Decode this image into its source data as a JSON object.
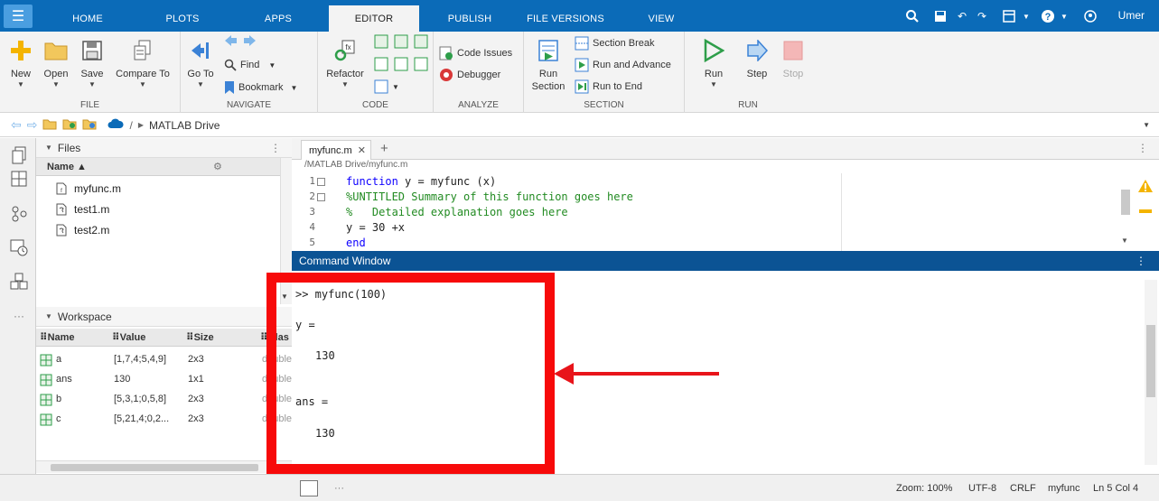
{
  "tabs": [
    {
      "label": "HOME",
      "active": false
    },
    {
      "label": "PLOTS",
      "active": false
    },
    {
      "label": "APPS",
      "active": false
    },
    {
      "label": "EDITOR",
      "active": true
    },
    {
      "label": "PUBLISH",
      "active": false
    },
    {
      "label": "FILE VERSIONS",
      "active": false
    },
    {
      "label": "VIEW",
      "active": false
    }
  ],
  "user": {
    "name": "Umer"
  },
  "ribbon": {
    "file": {
      "label": "FILE",
      "new": "New",
      "open": "Open",
      "save": "Save",
      "compare": "Compare To"
    },
    "navigate": {
      "label": "NAVIGATE",
      "goto": "Go To",
      "find": "Find",
      "bookmark": "Bookmark"
    },
    "code": {
      "label": "CODE",
      "refactor": "Refactor"
    },
    "analyze": {
      "label": "ANALYZE",
      "code_issues": "Code Issues",
      "debugger": "Debugger"
    },
    "section": {
      "label": "SECTION",
      "run_section_1": "Run",
      "run_section_2": "Section",
      "section_break": "Section Break",
      "run_advance": "Run and Advance",
      "run_end": "Run to End"
    },
    "run": {
      "label": "RUN",
      "run": "Run",
      "step": "Step",
      "stop": "Stop"
    }
  },
  "address": {
    "separator": "/",
    "location": "MATLAB Drive"
  },
  "files": {
    "title": "Files",
    "col_name": "Name ▲",
    "items": [
      "myfunc.m",
      "test1.m",
      "test2.m"
    ]
  },
  "workspace": {
    "title": "Workspace",
    "columns": [
      "Name",
      "Value",
      "Size",
      "Clas"
    ],
    "rows": [
      {
        "name": "a",
        "value": "[1,7,4;5,4,9]",
        "size": "2x3",
        "class": "double"
      },
      {
        "name": "ans",
        "value": "130",
        "size": "1x1",
        "class": "double"
      },
      {
        "name": "b",
        "value": "[5,3,1;0,5,8]",
        "size": "2x3",
        "class": "double"
      },
      {
        "name": "c",
        "value": "[5,21,4;0,2...",
        "size": "2x3",
        "class": "double"
      }
    ]
  },
  "editor": {
    "tab_name": "myfunc.m",
    "path": "/MATLAB Drive/myfunc.m",
    "line_numbers": [
      "1",
      "2",
      "3",
      "4",
      "5"
    ],
    "lines": [
      {
        "kw": "function",
        "rest": " y = myfunc (x)"
      },
      {
        "comment": "%UNTITLED Summary of this function goes here"
      },
      {
        "comment": "%   Detailed explanation goes here"
      },
      {
        "plain": "y = 30 +x"
      },
      {
        "kw": "end"
      }
    ]
  },
  "command_window": {
    "title": "Command Window",
    "lines": [
      ">> myfunc(100)",
      "y =",
      "130",
      "ans =",
      "130"
    ]
  },
  "status": {
    "zoom": "Zoom: 100%",
    "encoding": "UTF-8",
    "line_ending": "CRLF",
    "file": "myfunc",
    "position": "Ln 5  Col 4",
    "more": "···"
  },
  "colors": {
    "accent": "#0b6bb8",
    "annotation": "#f70a0a"
  }
}
